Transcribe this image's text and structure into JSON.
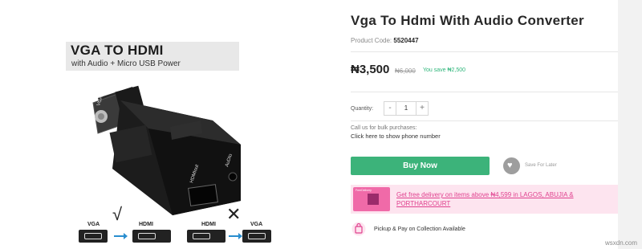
{
  "product": {
    "title": "Vga To Hdmi With Audio Converter",
    "code_label": "Product Code:",
    "code_value": "5520447",
    "price": "₦3,500",
    "old_price": "₦6,000",
    "savings": "You save ₦2,500"
  },
  "image": {
    "banner_title": "VGA TO HDMI",
    "banner_subtitle": "with Audio + Micro USB Power",
    "port_labels": {
      "vga_side": "VGA",
      "hdmi_out": "HDMIout",
      "audio": "AuDIo"
    },
    "diagram": {
      "ok_from": "VGA",
      "ok_to": "HDMI",
      "bad_from": "HDMI",
      "bad_to": "VGA",
      "ok_symbol": "√",
      "bad_symbol": "✕"
    }
  },
  "purchase": {
    "quantity_label": "Quantity:",
    "quantity_value": "1",
    "minus_label": "-",
    "plus_label": "+",
    "bulk_label": "Call us for bulk purchases:",
    "phone_link": "Click here to show phone number",
    "buy_button": "Buy Now",
    "save_later": "Save For Later"
  },
  "promo": {
    "thumb_text": "FreeDelivery",
    "text": "Get free delivery on items above ₦4,599 in LAGOS, ABUJIA & PORTHARCOURT"
  },
  "pickup": {
    "text": "Pickup & Pay on Collection Available"
  },
  "watermark": "wsxdn.com",
  "colors": {
    "buy_button": "#3cb37a",
    "savings": "#2db57a",
    "promo_bg": "#fde4ef",
    "promo_text": "#e0408e"
  }
}
